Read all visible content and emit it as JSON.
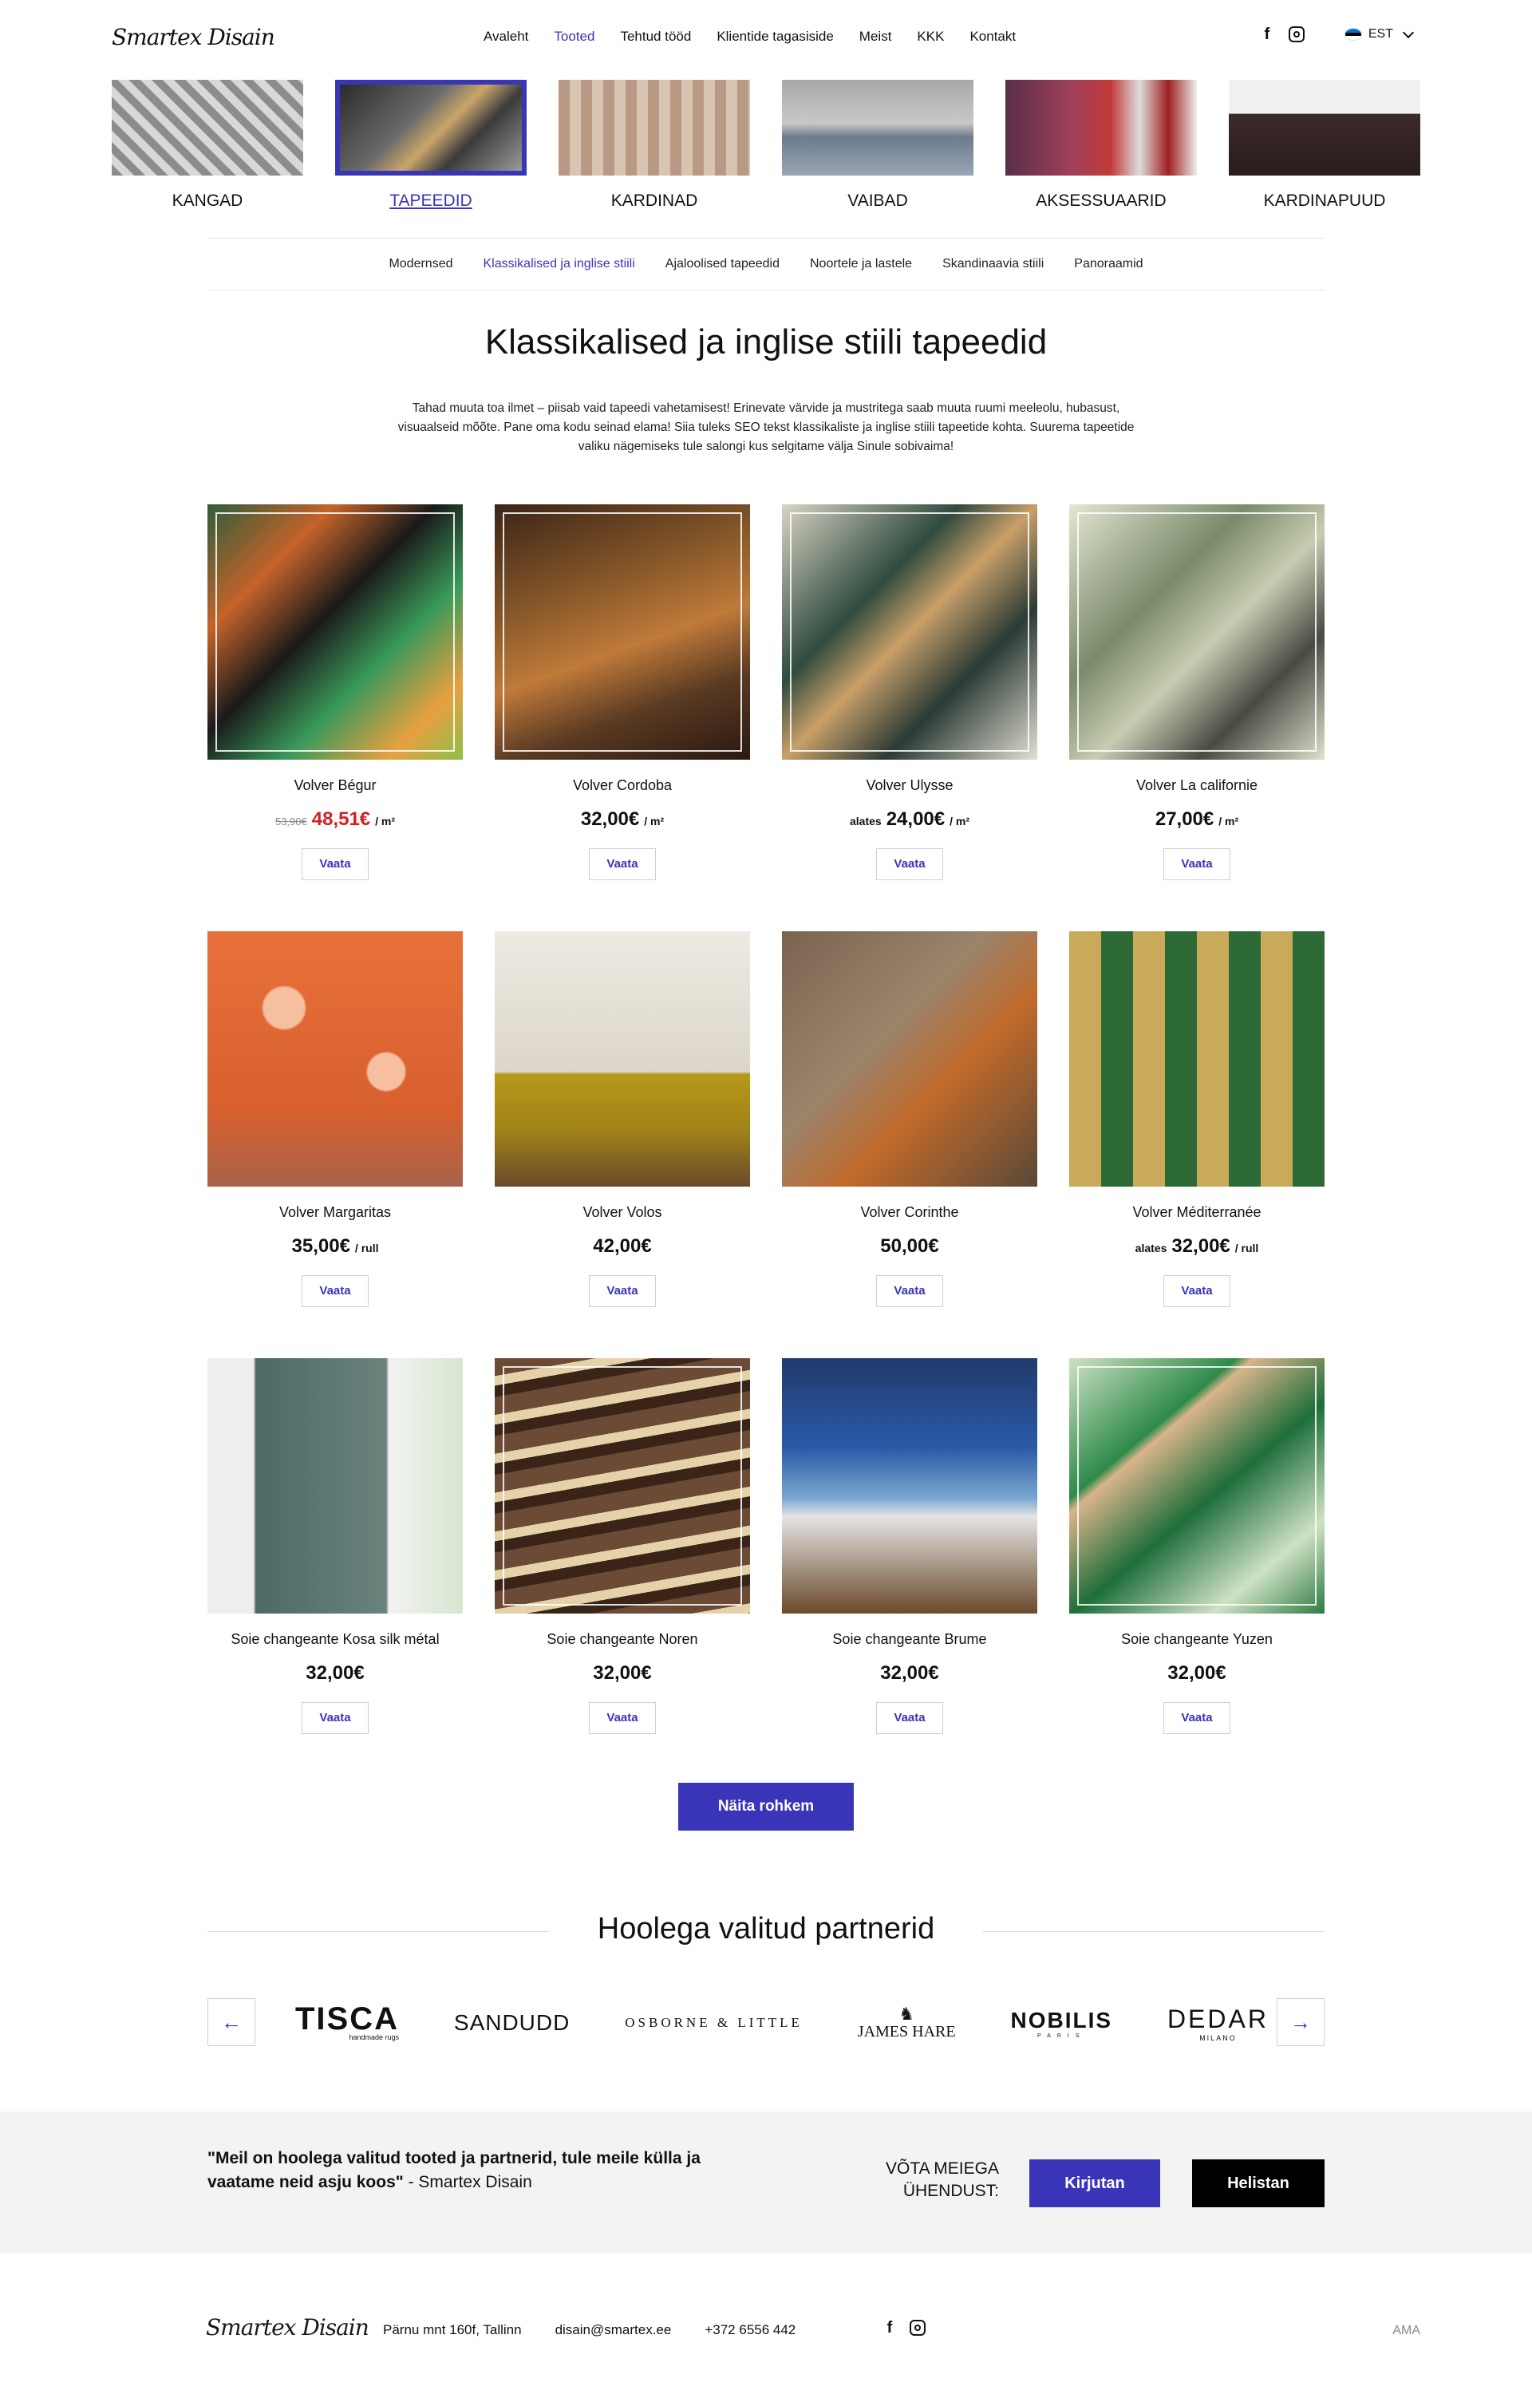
{
  "header": {
    "logo": "Smartex Disain",
    "nav": [
      "Avaleht",
      "Tooted",
      "Tehtud tööd",
      "Klientide tagasiside",
      "Meist",
      "KKK",
      "Kontakt"
    ],
    "nav_active": "Tooted",
    "social": [
      "facebook-icon",
      "instagram-icon"
    ],
    "language": "EST"
  },
  "categories": [
    "KANGAD",
    "TAPEEDID",
    "KARDINAD",
    "VAIBAD",
    "AKSESSUAARID",
    "KARDINAPUUD"
  ],
  "categories_active": "TAPEEDID",
  "subnav": [
    "Modernsed",
    "Klassikalised ja inglise stiili",
    "Ajaloolised tapeedid",
    "Noortele ja lastele",
    "Skandinaavia stiili",
    "Panoraamid"
  ],
  "subnav_active": "Klassikalised ja inglise stiili",
  "page": {
    "title": "Klassikalised ja inglise stiili tapeedid",
    "intro": "Tahad muuta toa ilmet – piisab vaid tapeedi vahetamisest! Erinevate värvide ja mustritega saab muuta ruumi meeleolu, hubasust, visuaalseid mõõte. Pane oma kodu seinad elama! Siia tuleks SEO tekst klassikaliste ja inglise stiili tapeetide kohta. Suurema  tapeetide valiku nägemiseks tule salongi kus selgitame välja Sinule sobivaima!"
  },
  "products": [
    {
      "name": "Volver Bégur",
      "old": "53,90€",
      "price": "48,51€",
      "prefix": "",
      "unit": "/ m²",
      "sale": true
    },
    {
      "name": "Volver Cordoba",
      "old": "",
      "price": "32,00€",
      "prefix": "",
      "unit": "/ m²",
      "sale": false
    },
    {
      "name": "Volver Ulysse",
      "old": "",
      "price": "24,00€",
      "prefix": "alates",
      "unit": "/ m²",
      "sale": false
    },
    {
      "name": "Volver La californie",
      "old": "",
      "price": "27,00€",
      "prefix": "",
      "unit": "/ m²",
      "sale": false
    },
    {
      "name": "Volver Margaritas",
      "old": "",
      "price": "35,00€",
      "prefix": "",
      "unit": "/ rull",
      "sale": false
    },
    {
      "name": "Volver Volos",
      "old": "",
      "price": "42,00€",
      "prefix": "",
      "unit": "",
      "sale": false
    },
    {
      "name": "Volver Corinthe",
      "old": "",
      "price": "50,00€",
      "prefix": "",
      "unit": "",
      "sale": false
    },
    {
      "name": "Volver Méditerranée",
      "old": "",
      "price": "32,00€",
      "prefix": "alates",
      "unit": "/ rull",
      "sale": false
    },
    {
      "name": "Soie changeante Kosa silk métal",
      "old": "",
      "price": "32,00€",
      "prefix": "",
      "unit": "",
      "sale": false
    },
    {
      "name": "Soie changeante Noren",
      "old": "",
      "price": "32,00€",
      "prefix": "",
      "unit": "",
      "sale": false
    },
    {
      "name": "Soie changeante Brume",
      "old": "",
      "price": "32,00€",
      "prefix": "",
      "unit": "",
      "sale": false
    },
    {
      "name": "Soie changeante Yuzen",
      "old": "",
      "price": "32,00€",
      "prefix": "",
      "unit": "",
      "sale": false
    }
  ],
  "view_label": "Vaata",
  "more_label": "Näita rohkem",
  "partners": {
    "title": "Hoolega valitud partnerid",
    "brands": [
      "TISCA",
      "SANDUDD",
      "OSBORNE & LITTLE",
      "JAMES HARE",
      "NOBILIS",
      "DEDAR"
    ],
    "tisca_sub": "handmade rugs",
    "nobilis_sub": "PARIS",
    "dedar_sub": "MILANO",
    "prev": "←",
    "next": "→"
  },
  "cta": {
    "quote": "\"Meil on hoolega valitud tooted ja partnerid, tule meile külla ja vaatame neid asju koos\"",
    "author": " - Smartex Disain",
    "contact_label": "VÕTA MEIEGA ÜHENDUST:",
    "write": "Kirjutan",
    "call": "Helistan"
  },
  "footer": {
    "logo": "Smartex Disain",
    "address": "Pärnu mnt 160f, Tallinn",
    "email": "disain@smartex.ee",
    "phone": "+372 6556 442",
    "credit": "AMA"
  },
  "colors": {
    "accent": "#3a35b8",
    "sale": "#d42020",
    "cta_bg": "#f3f3f3"
  }
}
